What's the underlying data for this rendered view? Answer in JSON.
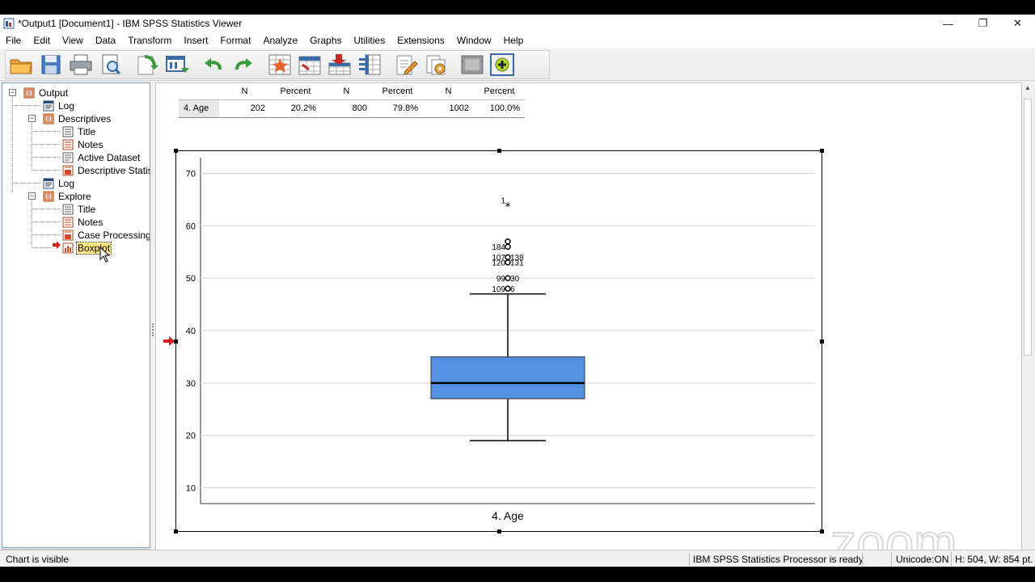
{
  "window": {
    "title": "*Output1 [Document1] - IBM SPSS Statistics Viewer",
    "controls": [
      "minimize-icon",
      "restore-icon",
      "close-icon"
    ]
  },
  "menu": [
    "File",
    "Edit",
    "View",
    "Data",
    "Transform",
    "Insert",
    "Format",
    "Analyze",
    "Graphs",
    "Utilities",
    "Extensions",
    "Window",
    "Help"
  ],
  "toolbar": {
    "buttons": [
      "open-icon",
      "save-icon",
      "print-icon",
      "print-preview-icon",
      "export-icon",
      "recall-dialog-icon",
      "undo-icon",
      "redo-icon",
      "goto-data-icon",
      "goto-case-icon",
      "insert-case-icon",
      "variables-icon",
      "designate-window-icon",
      "script-icon",
      "hide-icon",
      "show-icon"
    ]
  },
  "tree": {
    "items": [
      {
        "label": "Output",
        "icon": "output-book-icon",
        "level": 0,
        "expander": "minus"
      },
      {
        "label": "Log",
        "icon": "log-icon",
        "level": 1
      },
      {
        "label": "Descriptives",
        "icon": "procedure-book-icon",
        "level": 1,
        "expander": "minus"
      },
      {
        "label": "Title",
        "icon": "title-icon",
        "level": 2
      },
      {
        "label": "Notes",
        "icon": "notes-icon",
        "level": 2
      },
      {
        "label": "Active Dataset",
        "icon": "text-icon",
        "level": 2
      },
      {
        "label": "Descriptive Statis",
        "icon": "table-icon",
        "level": 2
      },
      {
        "label": "Log",
        "icon": "log-icon",
        "level": 1
      },
      {
        "label": "Explore",
        "icon": "procedure-book-icon",
        "level": 1,
        "expander": "minus"
      },
      {
        "label": "Title",
        "icon": "title-icon",
        "level": 2
      },
      {
        "label": "Notes",
        "icon": "notes-icon",
        "level": 2
      },
      {
        "label": "Case Processing",
        "icon": "table-icon",
        "level": 2
      },
      {
        "label": "Boxplot",
        "icon": "chart-icon",
        "level": 2,
        "selected": true
      }
    ]
  },
  "case_table": {
    "headers": [
      "N",
      "Percent",
      "N",
      "Percent",
      "N",
      "Percent"
    ],
    "row_label": "4. Age",
    "values": [
      "202",
      "20.2%",
      "800",
      "79.8%",
      "1002",
      "100.0%"
    ]
  },
  "chart_data": {
    "type": "boxplot",
    "category": "4. Age",
    "ylim": [
      7,
      73
    ],
    "yticks": [
      10,
      20,
      30,
      40,
      50,
      60,
      70
    ],
    "box": {
      "min": 19,
      "q1": 27,
      "median": 30,
      "q3": 35,
      "max": 47
    },
    "box_color": "#5491e2",
    "outliers": [
      {
        "value": 48,
        "label": "109",
        "marker": "circle"
      },
      {
        "value": 48,
        "label": "6",
        "marker": "circle"
      },
      {
        "value": 50,
        "label": "99",
        "marker": "circle"
      },
      {
        "value": 50,
        "label": "30",
        "marker": "circle"
      },
      {
        "value": 53,
        "label": "120",
        "marker": "circle"
      },
      {
        "value": 53,
        "label": "131",
        "marker": "circle"
      },
      {
        "value": 54,
        "label": "107",
        "marker": "circle"
      },
      {
        "value": 54,
        "label": "138",
        "marker": "circle"
      },
      {
        "value": 56,
        "label": "184",
        "marker": "circle"
      },
      {
        "value": 57,
        "label": "",
        "marker": "circle"
      },
      {
        "value": 64,
        "label": "1",
        "marker": "star"
      }
    ],
    "grid": true
  },
  "watermark": "zoom",
  "status": {
    "message": "Chart is visible",
    "processor": "IBM SPSS Statistics Processor is ready",
    "unicode": "Unicode:ON",
    "dims": "H: 504, W: 854 pt."
  }
}
